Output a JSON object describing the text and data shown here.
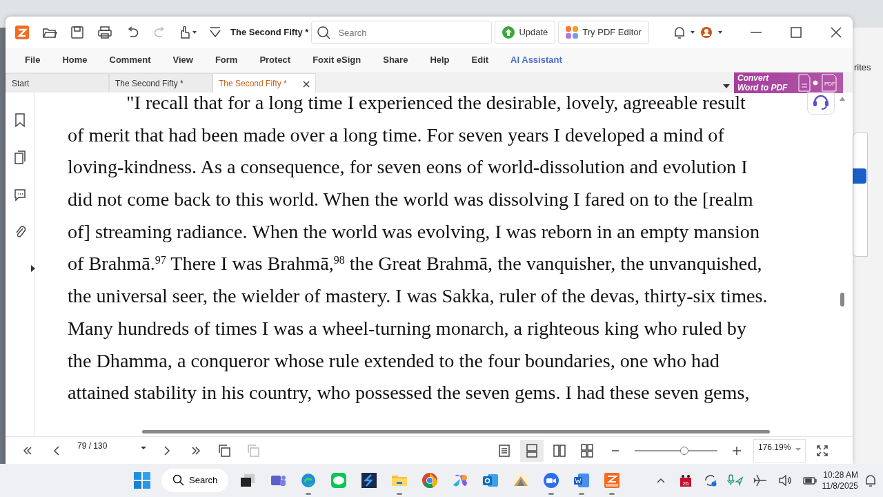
{
  "background": {
    "side_text": "rites"
  },
  "toolbar": {
    "doc_title": "The Second Fifty *",
    "search": {
      "placeholder": "Search"
    },
    "buttons": [
      {
        "label": "Update",
        "kind": "update"
      },
      {
        "label": "Try PDF Editor",
        "kind": "editor"
      }
    ]
  },
  "menu": [
    {
      "label": "File",
      "kind": "plain"
    },
    {
      "label": "Home",
      "kind": "plain"
    },
    {
      "label": "Comment",
      "kind": "plain"
    },
    {
      "label": "View",
      "kind": "plain"
    },
    {
      "label": "Form",
      "kind": "plain"
    },
    {
      "label": "Protect",
      "kind": "plain"
    },
    {
      "label": "Foxit eSign",
      "kind": "plain"
    },
    {
      "label": "Share",
      "kind": "plain"
    },
    {
      "label": "Help",
      "kind": "plain"
    },
    {
      "label": "Edit",
      "kind": "plain"
    },
    {
      "label": "AI Assistant",
      "kind": "ai"
    }
  ],
  "tabs": [
    {
      "label": "Start",
      "selected": false,
      "closable": false
    },
    {
      "label": "The Second Fifty *",
      "selected": false,
      "closable": false
    },
    {
      "label": "The Second Fifty *",
      "selected": true,
      "closable": true
    }
  ],
  "banner": {
    "line1": "Convert",
    "line2": "Word to PDF",
    "icon_label": "PDF"
  },
  "document": {
    "lines": [
      {
        "text": "\"I recall that for a long time I experienced the desirable, lovely, agreeable result",
        "indent": true
      },
      {
        "text": "of merit that had been made over a long time. For seven years I developed a mind of",
        "indent": false
      },
      {
        "text": "loving-kindness. As a consequence, for seven eons of world-dissolution and evolution I",
        "indent": false
      },
      {
        "text": "did not come back to this world. When the world was dissolving I fared on to the [realm",
        "indent": false
      },
      {
        "text": "of] streaming radiance. When the world was evolving, I was reborn in an empty mansion",
        "indent": false
      },
      {
        "text": "of Brahmā.$^{97}$ There I was Brahmā,$^{98}$ the Great Brahmā, the vanquisher, the unvanquished,",
        "indent": false
      },
      {
        "text": "the universal seer, the wielder of mastery. I was Sakka, ruler of the devas, thirty-six times.",
        "indent": false
      },
      {
        "text": "Many hundreds of times I was a wheel-turning monarch, a righteous king who ruled by",
        "indent": false
      },
      {
        "text": "the Dhamma, a conqueror whose rule extended to the four boundaries, one who had",
        "indent": false
      },
      {
        "text": "attained stability in his country, who possessed the seven gems. I had these seven gems,",
        "indent": false
      }
    ]
  },
  "status_bar": {
    "page": "79 / 130",
    "view_modes": [
      {
        "selected": false
      },
      {
        "selected": true
      },
      {
        "selected": false
      },
      {
        "selected": false
      }
    ],
    "zoom": {
      "level": 0.6
    },
    "zoom_text": "176.19%"
  },
  "taskbar": {
    "search": "Search",
    "apps": [
      {
        "kind": "teams",
        "running": false
      },
      {
        "kind": "edge",
        "running": true
      },
      {
        "kind": "line",
        "running": false
      },
      {
        "kind": "s",
        "running": false
      },
      {
        "kind": "folder",
        "running": true
      },
      {
        "kind": "chrome",
        "running": false
      },
      {
        "kind": "copilot",
        "running": false
      },
      {
        "kind": "outlook",
        "running": false
      },
      {
        "kind": "fan",
        "running": false
      },
      {
        "kind": "zoom",
        "running": true
      },
      {
        "kind": "word",
        "running": true
      },
      {
        "kind": "reader",
        "running": true
      }
    ],
    "calendar_badge": "26",
    "time": "10:28 AM",
    "date": "11/8/2025"
  }
}
